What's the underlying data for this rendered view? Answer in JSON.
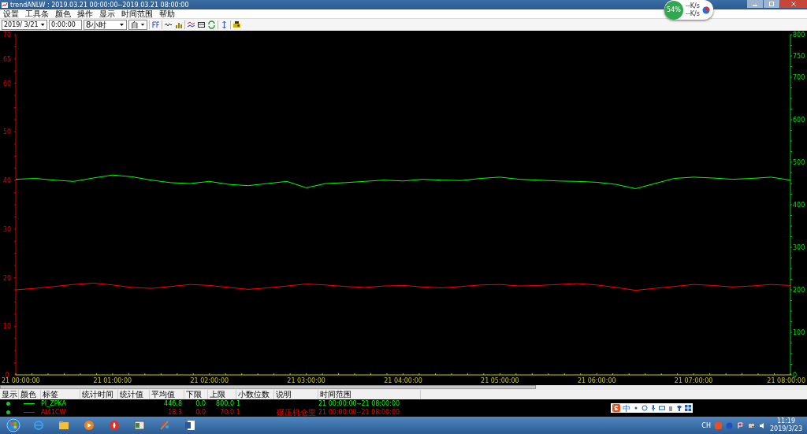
{
  "window": {
    "title": "trendANLW : 2019.03.21 00:00:00--2019.03.21 08:00:00"
  },
  "network_widget": {
    "percent": "54%",
    "upload": "--K/s",
    "download": "--K/s"
  },
  "menu": [
    "设置",
    "工具条",
    "颜色",
    "操作",
    "显示",
    "时间范围",
    "帮助"
  ],
  "toolbar": {
    "date": "2019/ 3/21",
    "time": "0:00:00",
    "span": "8小时",
    "direction": "自"
  },
  "chart": {
    "chart_data": {
      "type": "line",
      "categories": [
        "21 00:00:00",
        null,
        null,
        null,
        null,
        "21 01:00:00",
        null,
        null,
        null,
        null,
        "21 02:00:00",
        null,
        null,
        null,
        null,
        "21 03:00:00",
        null,
        null,
        null,
        null,
        "21 04:00:00",
        null,
        null,
        null,
        null,
        "21 05:00:00",
        null,
        null,
        null,
        null,
        "21 06:00:00",
        null,
        null,
        null,
        null,
        "21 07:00:00",
        null,
        null,
        null,
        null,
        "21 08:00:00"
      ],
      "ylim": [
        0,
        70
      ],
      "yticks": [
        0,
        10,
        20,
        30,
        40,
        50,
        60,
        65,
        70
      ],
      "y2lim": [
        0,
        800
      ],
      "y2ticks": [
        0,
        100,
        200,
        300,
        400,
        500,
        600,
        700,
        750,
        800
      ],
      "series": [
        {
          "name": "PI_ZPKA",
          "color": "#00ff00",
          "axis": "y2",
          "values": [
            460,
            462,
            458,
            455,
            463,
            470,
            466,
            458,
            452,
            450,
            455,
            448,
            445,
            450,
            455,
            440,
            450,
            452,
            455,
            458,
            456,
            460,
            458,
            457,
            462,
            465,
            460,
            458,
            456,
            455,
            453,
            448,
            438,
            450,
            462,
            465,
            463,
            460,
            462,
            465,
            458
          ]
        },
        {
          "name": "AI41CW",
          "color": "#ff0000",
          "values": [
            17.5,
            17.8,
            18.2,
            18.6,
            18.9,
            18.5,
            18.0,
            17.8,
            18.2,
            18.6,
            18.4,
            18.0,
            17.6,
            17.9,
            18.3,
            18.7,
            18.5,
            18.2,
            18.0,
            18.3,
            18.4,
            18.1,
            17.9,
            18.2,
            18.5,
            18.6,
            18.3,
            18.4,
            18.6,
            18.8,
            18.5,
            18.0,
            17.4,
            17.8,
            18.2,
            18.6,
            18.4,
            18.1,
            18.3,
            18.6,
            18.4
          ]
        }
      ]
    }
  },
  "legend": {
    "columns": [
      "显示",
      "颜色",
      "标签",
      "统计时间",
      "统计值",
      "平均值",
      "下限",
      "上限",
      "小数位数",
      "说明",
      "时间范围"
    ],
    "rows": [
      {
        "shown": true,
        "average": "446.8",
        "low": "0.0",
        "high": "800.0",
        "decimals": "1",
        "time_range": "21 00:00:00--21 08:00:00"
      },
      {
        "shown": true,
        "average": "18.3",
        "low": "0.0",
        "high": "70.0",
        "decimals": "1",
        "note": "碾压机仓里",
        "time_range": "21 00:00:00--21 08:00:00"
      }
    ]
  },
  "ime_toolbar": {
    "mode": "中"
  },
  "taskbar": {
    "language": "CH",
    "time": "11:19",
    "date": "2019/3/23"
  }
}
